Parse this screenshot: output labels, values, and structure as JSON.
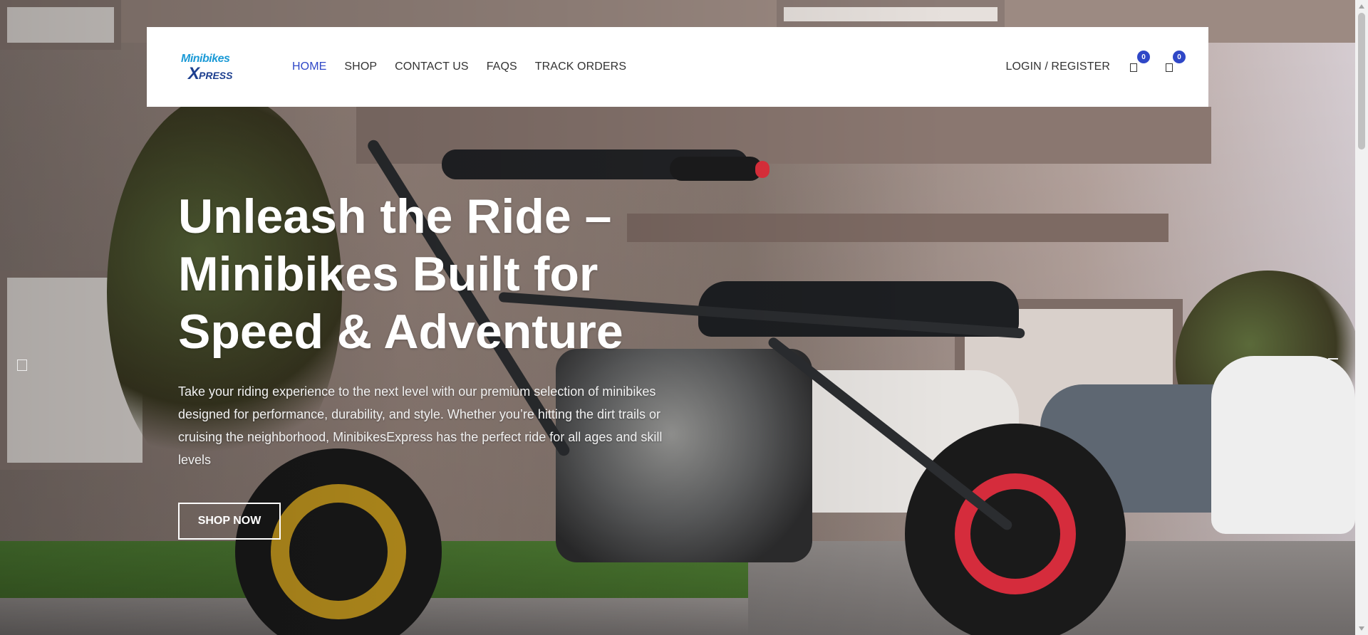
{
  "header": {
    "logo": {
      "line1": "Minibikes",
      "line2_main": "X",
      "line2_rest": "PRESS"
    },
    "nav": [
      {
        "label": "HOME",
        "active": true
      },
      {
        "label": "SHOP",
        "active": false
      },
      {
        "label": "CONTACT US",
        "active": false
      },
      {
        "label": "FAQS",
        "active": false
      },
      {
        "label": "TRACK ORDERS",
        "active": false
      }
    ],
    "login_label": "LOGIN / REGISTER",
    "wishlist": {
      "icon": "wishlist-icon",
      "count": "0"
    },
    "cart": {
      "icon": "cart-icon",
      "count": "0"
    }
  },
  "hero": {
    "title": "Unleash the Ride – Minibikes Built for Speed & Adventure",
    "description": "Take your riding experience to the next level with our premium selection of minibikes designed for performance, durability, and style. Whether you’re hitting the dirt trails or cruising the neighborhood, MinibikesExpress has the perfect ride for all ages and skill levels",
    "cta_label": "SHOP NOW",
    "background": "minibike-photo"
  },
  "slider": {
    "prev_icon": "slider-prev-icon",
    "next_icon": "slider-next-icon"
  },
  "colors": {
    "accent": "#2f47c7",
    "badge": "#2f47c7",
    "header_bg": "#ffffff",
    "nav_text": "#333333",
    "hero_text": "#ffffff"
  }
}
